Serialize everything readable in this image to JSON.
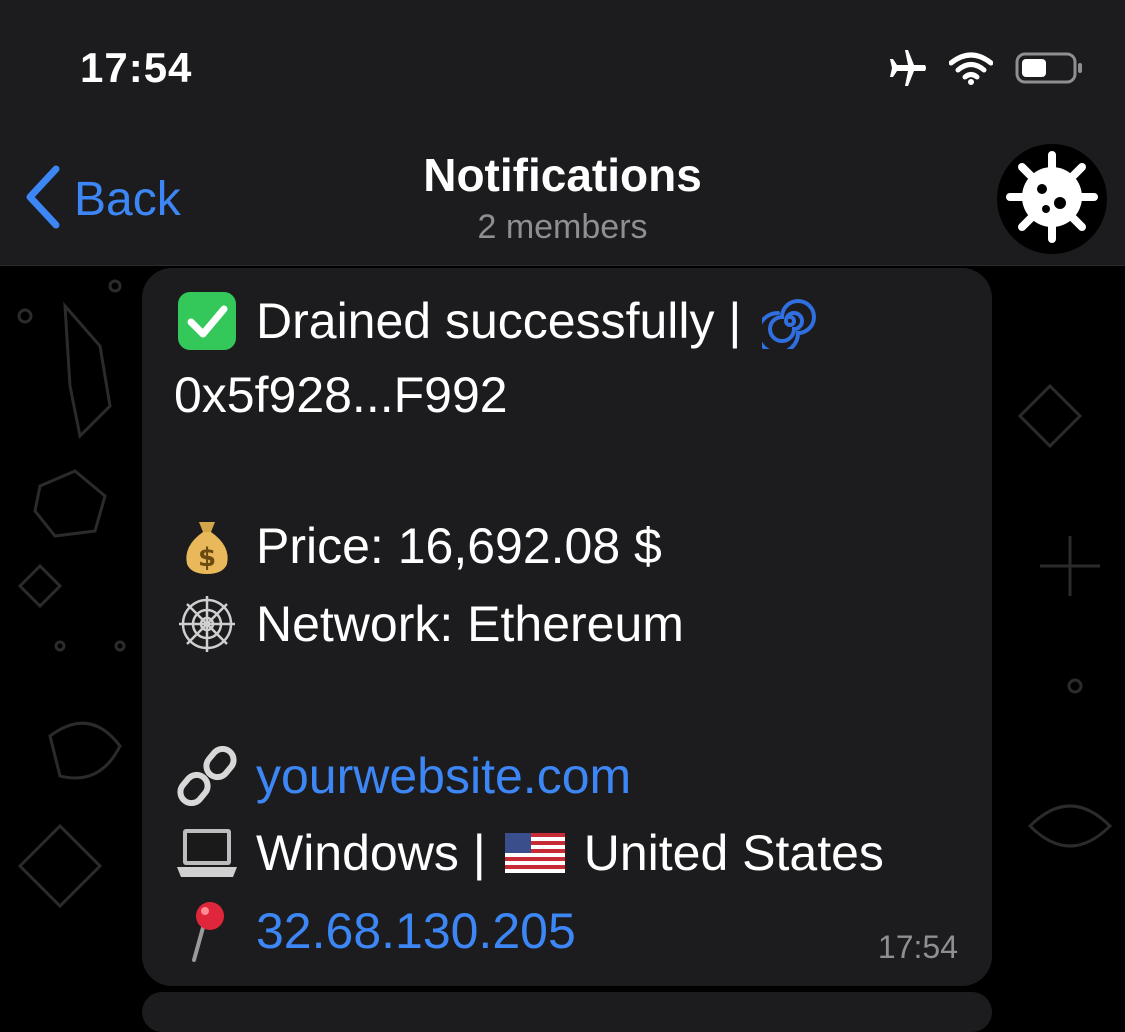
{
  "status_bar": {
    "time": "17:54",
    "icons": [
      "airplane-icon",
      "wifi-icon",
      "battery-icon"
    ]
  },
  "header": {
    "back_label": "Back",
    "title": "Notifications",
    "subtitle": "2 members",
    "avatar_icon": "virus-icon"
  },
  "message": {
    "line1_text": "Drained successfully |",
    "address": "0x5f928...F992",
    "price_text": "Price: 16,692.08 $",
    "network_text": "Network: Ethereum",
    "website": "yourwebsite.com",
    "os_text": "Windows |",
    "country_text": "United States",
    "ip": "32.68.130.205",
    "time": "17:54",
    "emojis": [
      "check-icon",
      "swirl-icon",
      "money-bag-icon",
      "web-icon",
      "link-icon",
      "laptop-icon",
      "us-flag-icon",
      "pin-icon"
    ]
  },
  "colors": {
    "accent": "#3d86f5",
    "bubble": "#1c1c1e",
    "header": "#1c1c1e",
    "secondary_text": "#8e8e93",
    "check_green": "#34c759"
  }
}
